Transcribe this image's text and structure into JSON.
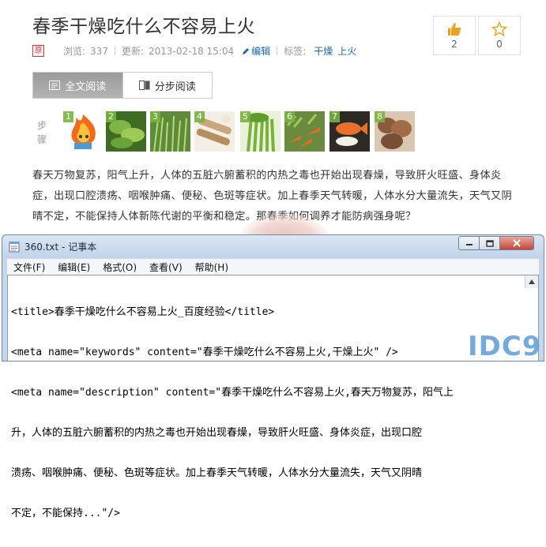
{
  "article": {
    "title": "春季干燥吃什么不容易上火",
    "original_badge": "原",
    "views_label": "浏览:",
    "views_value": "337",
    "updated_label": "更新:",
    "updated_value": "2013-02-18 15:04",
    "edit_label": "编辑",
    "tags_label": "标签:",
    "tags": [
      "干燥",
      "上火"
    ]
  },
  "votes": {
    "useful_count": "2",
    "favorite_count": "0"
  },
  "tabs": [
    {
      "label": "全文阅读",
      "active": true
    },
    {
      "label": "分步阅读",
      "active": false
    }
  ],
  "steps": {
    "label": "步骤",
    "items": [
      {
        "num": "1",
        "icon": "fire-character-image"
      },
      {
        "num": "2",
        "icon": "greens-image"
      },
      {
        "num": "3",
        "icon": "grass-image"
      },
      {
        "num": "4",
        "icon": "yam-image"
      },
      {
        "num": "5",
        "icon": "celery-image"
      },
      {
        "num": "6",
        "icon": "carrots-image"
      },
      {
        "num": "7",
        "icon": "fish-image"
      },
      {
        "num": "8",
        "icon": "taro-image"
      }
    ]
  },
  "body_text": "春天万物复苏，阳气上升，人体的五脏六腑蓄积的内热之毒也开始出现春燥，导致肝火旺盛、身体炎症，出现口腔溃疡、咽喉肿痛、便秘、色斑等症状。加上春季天气转暖，人体水分大量流失，天气又阴晴不定，不能保持人体新陈代谢的平衡和稳定。那春季如何调养才能防病强身呢？",
  "notepad": {
    "title": "360.txt - 记事本",
    "menu": [
      "文件(F)",
      "编辑(E)",
      "格式(O)",
      "查看(V)",
      "帮助(H)"
    ],
    "lines": [
      "<title>春季干燥吃什么不容易上火_百度经验</title>",
      "<meta name=\"keywords\" content=\"春季干燥吃什么不容易上火,干燥上火\" />",
      "<meta name=\"description\" content=\"春季干燥吃什么不容易上火,春天万物复苏，阳气上",
      "升，人体的五脏六腑蓄积的内热之毒也开始出现春燥，导致肝火旺盛、身体炎症，出现口腔",
      "溃疡、咽喉肿痛、便秘、色斑等症状。加上春季天气转暖，人体水分大量流失，天气又阴晴",
      "不定，不能保持...\"/>"
    ]
  },
  "watermark": "IDC9",
  "colors": {
    "link": "#1a64b5",
    "vote_icon": "#f0a020",
    "accent_tab": "#a6a6a6"
  }
}
